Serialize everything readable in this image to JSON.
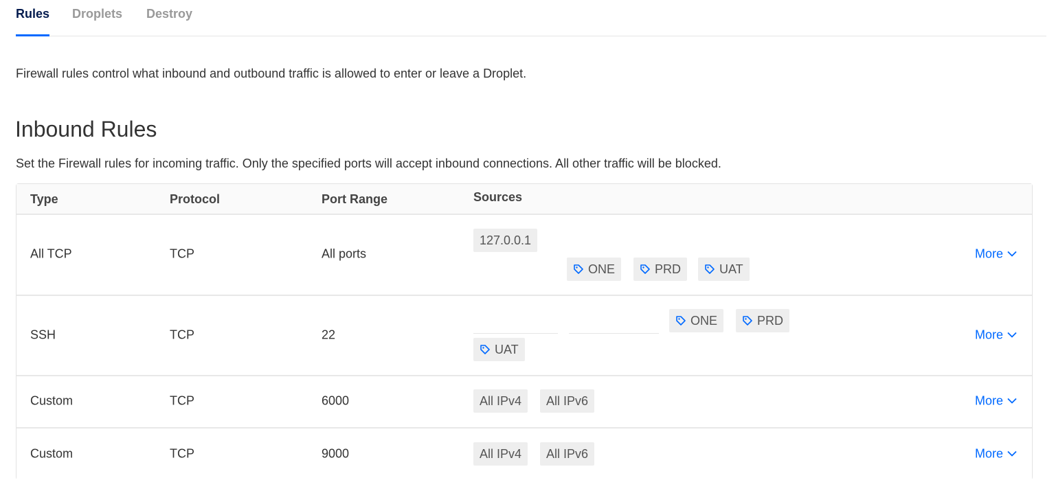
{
  "tabs": [
    {
      "label": "Rules",
      "active": true
    },
    {
      "label": "Droplets",
      "active": false
    },
    {
      "label": "Destroy",
      "active": false
    }
  ],
  "intro": "Firewall rules control what inbound and outbound traffic is allowed to enter or leave a Droplet.",
  "inbound": {
    "title": "Inbound Rules",
    "description": "Set the Firewall rules for incoming traffic. Only the specified ports will accept inbound connections. All other traffic will be blocked.",
    "columns": [
      "Type",
      "Protocol",
      "Port Range",
      "Sources"
    ],
    "more_label": "More",
    "rows": [
      {
        "type": "All TCP",
        "protocol": "TCP",
        "port_range": "All ports",
        "sources": [
          "127.0.0.1"
        ],
        "tags": [
          "ONE",
          "PRD",
          "UAT"
        ]
      },
      {
        "type": "SSH",
        "protocol": "TCP",
        "port_range": "22",
        "sources": [],
        "tags": [
          "ONE",
          "PRD",
          "UAT"
        ]
      },
      {
        "type": "Custom",
        "protocol": "TCP",
        "port_range": "6000",
        "sources": [
          "All IPv4",
          "All IPv6"
        ],
        "tags": []
      },
      {
        "type": "Custom",
        "protocol": "TCP",
        "port_range": "9000",
        "sources": [
          "All IPv4",
          "All IPv6"
        ],
        "tags": []
      }
    ]
  },
  "colors": {
    "accent": "#0069ff",
    "tab_active": "#031b4e",
    "tab_inactive": "#999999",
    "chip_bg": "#eeeeee"
  }
}
